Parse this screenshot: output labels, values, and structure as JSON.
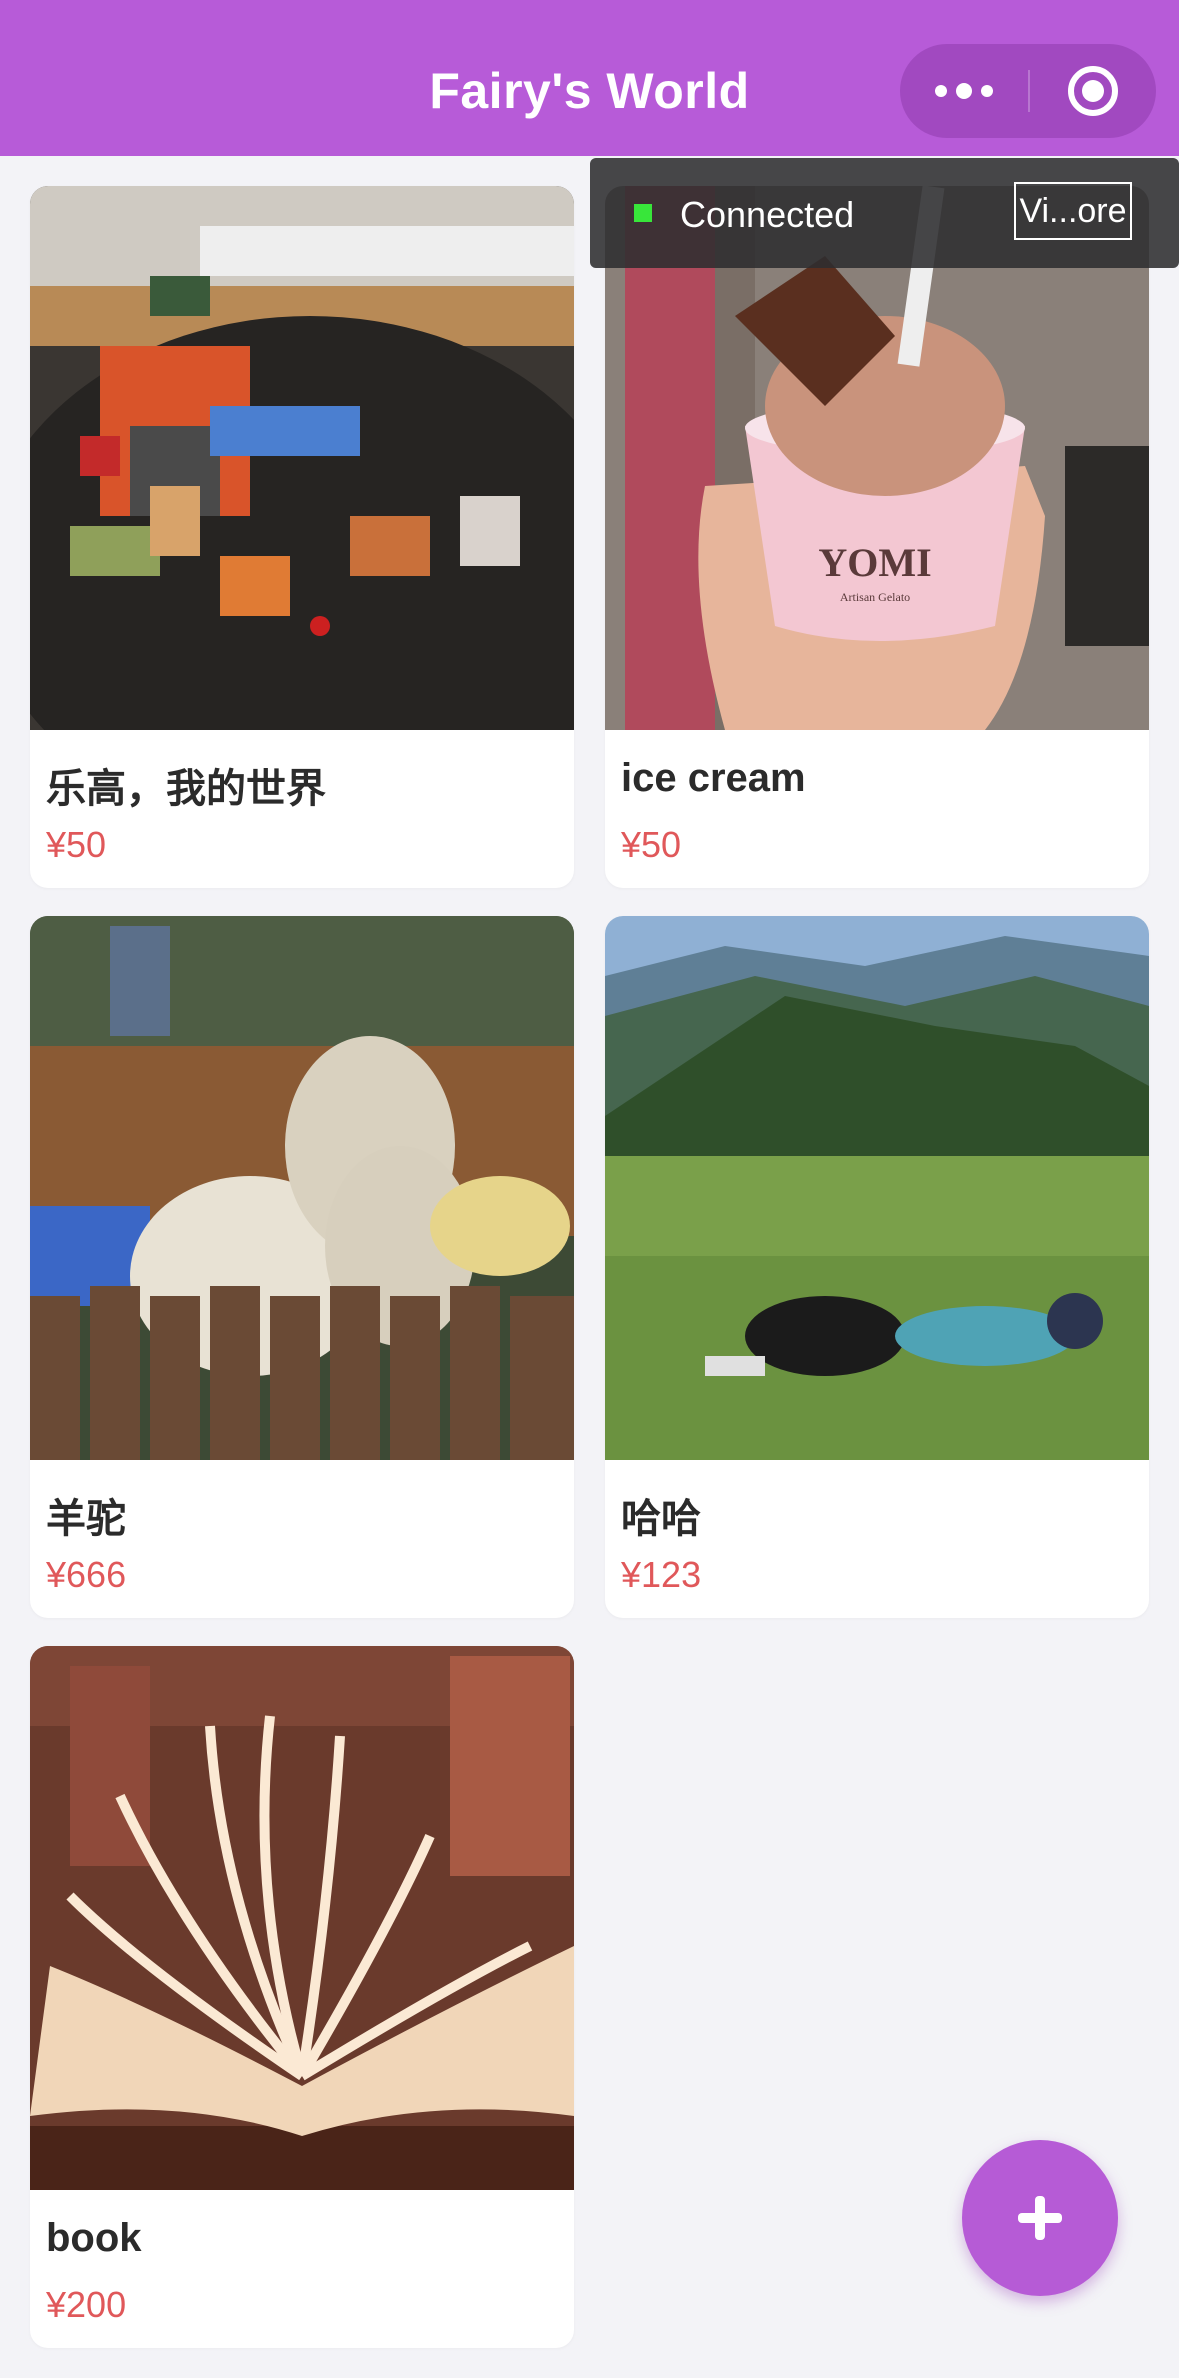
{
  "header": {
    "title": "Fairy's World",
    "bg_color": "#b75bd8"
  },
  "capsule": {
    "more_icon": "ellipsis-icon",
    "close_icon": "target-circle-icon"
  },
  "debug": {
    "status": "Connected",
    "button_label": "Vi...ore",
    "status_color": "#38e63a"
  },
  "products": [
    {
      "title": "乐高，我的世界",
      "price": "¥50",
      "image": "lego-minecraft-photo"
    },
    {
      "title": "ice cream",
      "price": "¥50",
      "image": "ice-cream-cup-photo",
      "cup_text": "YOMI",
      "cup_subtext": "Artisan Gelato"
    },
    {
      "title": "羊驼",
      "price": "¥666",
      "image": "alpaca-photo"
    },
    {
      "title": "哈哈",
      "price": "¥123",
      "image": "mountain-meadow-photo"
    },
    {
      "title": "book",
      "price": "¥200",
      "image": "open-book-photo"
    }
  ],
  "fab": {
    "icon": "plus-icon",
    "color": "#b65bd6"
  },
  "price_color": "#e0585a"
}
